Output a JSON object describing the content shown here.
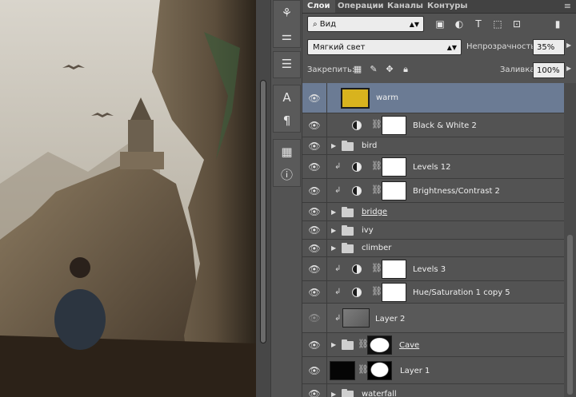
{
  "tabs": [
    "Слои",
    "Операции",
    "Каналы",
    "Контуры"
  ],
  "tab_menu_icon": "menu-icon",
  "filter": {
    "kind_label": "Вид",
    "kind_icon": "search-icon"
  },
  "blend": {
    "mode": "Мягкий свет",
    "opacity_label": "Непрозрачность:",
    "opacity": "35%"
  },
  "lock": {
    "label": "Закрепить:",
    "fill_label": "Заливка:",
    "fill": "100%"
  },
  "layers": [
    {
      "name": "warm",
      "kind": "color-fill",
      "selected": true,
      "thumb_color": "#d8b31e"
    },
    {
      "name": "Black & White 2",
      "kind": "adjustment"
    },
    {
      "name": "bird",
      "kind": "group"
    },
    {
      "name": "Levels 12",
      "kind": "adjustment",
      "clipped": true
    },
    {
      "name": "Brightness/Contrast 2",
      "kind": "adjustment",
      "clipped": true
    },
    {
      "name": "bridge",
      "kind": "group",
      "underline": true
    },
    {
      "name": "ivy",
      "kind": "group"
    },
    {
      "name": "climber",
      "kind": "group"
    },
    {
      "name": "Levels 3",
      "kind": "adjustment",
      "clipped": true
    },
    {
      "name": "Hue/Saturation 1 copy 5",
      "kind": "adjustment",
      "clipped": true
    },
    {
      "name": "Layer 2",
      "kind": "pixel",
      "clipped": true,
      "hidden_eye": true
    },
    {
      "name": "Cave",
      "kind": "group-mask",
      "underline": true
    },
    {
      "name": "Layer 1",
      "kind": "pixel-mask"
    },
    {
      "name": "waterfall",
      "kind": "group",
      "underline": true
    }
  ]
}
